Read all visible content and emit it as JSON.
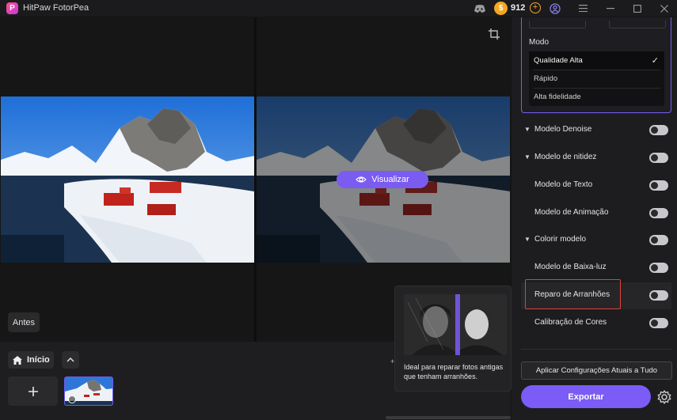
{
  "window": {
    "title": "HitPaw FotorPea",
    "coins": "912"
  },
  "preview": {
    "visualize_label": "Visualizar",
    "before_label": "Antes"
  },
  "bottom_bar": {
    "home_label": "Início"
  },
  "tooltip": {
    "text": "Ideal para reparar fotos antigas que tenham arranhões."
  },
  "panel": {
    "mode_label": "Modo",
    "mode_options": [
      "Qualidade Alta",
      "Rápido",
      "Alta fidelidade"
    ],
    "options": [
      {
        "label": "Modelo Denoise",
        "expandable": true,
        "on": false
      },
      {
        "label": "Modelo de nitidez",
        "expandable": true,
        "on": false
      },
      {
        "label": "Modelo de Texto",
        "expandable": false,
        "on": false
      },
      {
        "label": "Modelo de Animação",
        "expandable": false,
        "on": false
      },
      {
        "label": "Colorir modelo",
        "expandable": true,
        "on": false
      },
      {
        "label": "Modelo de Baixa-luz",
        "expandable": false,
        "on": false
      },
      {
        "label": "Reparo de Arranhões",
        "expandable": false,
        "on": false
      },
      {
        "label": "Calibração de Cores",
        "expandable": false,
        "on": false
      }
    ],
    "apply_label": "Aplicar Configurações Atuais a Tudo",
    "export_label": "Exportar"
  },
  "colors": {
    "accent": "#7b5cf6",
    "highlight_border": "#e0403a",
    "coin": "#f5a623"
  }
}
